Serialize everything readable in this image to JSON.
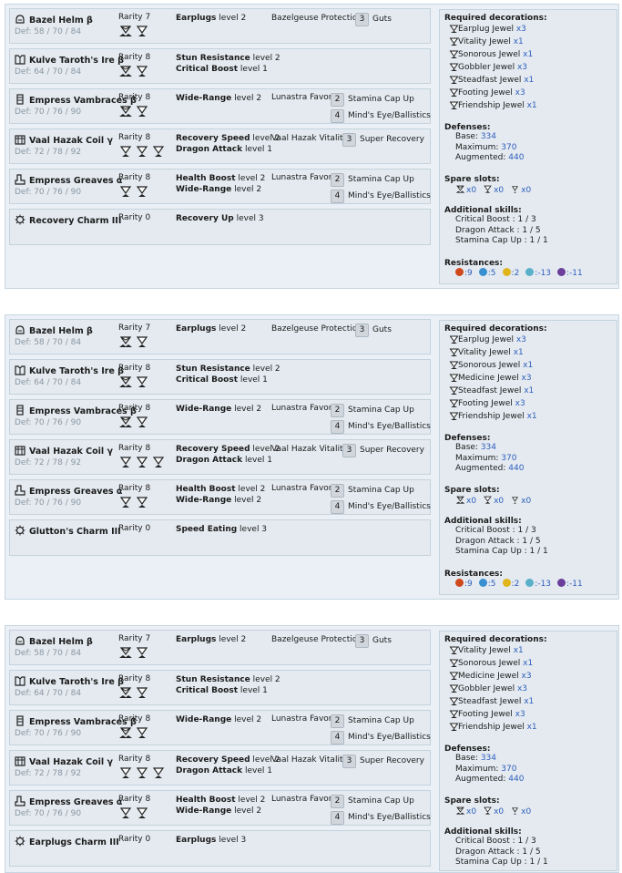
{
  "colors": {
    "accent": "#2f5fbd",
    "panel": "#e4eaf0",
    "border": "#c4d2dd"
  },
  "builds": [
    {
      "pieces": [
        {
          "name": "Bazel Helm β",
          "icon": "helm-icon",
          "def": "Def: 58 / 70 / 84",
          "rarity": "Rarity 7",
          "slots": [
            "large-slot",
            "medium-slot"
          ],
          "skills": [
            {
              "name": "Earplugs",
              "level": "level 2"
            }
          ],
          "set": "Bazelgeuse Protection",
          "bonuses": [
            {
              "n": "3",
              "text": "Guts"
            }
          ]
        },
        {
          "name": "Kulve Taroth's Ire β",
          "icon": "chest-icon",
          "def": "Def: 64 / 70 / 84",
          "rarity": "Rarity 8",
          "slots": [
            "large-slot",
            "medium-slot"
          ],
          "skills": [
            {
              "name": "Stun Resistance",
              "level": "level 2"
            },
            {
              "name": "Critical Boost",
              "level": "level 1"
            }
          ],
          "set": "",
          "bonuses": []
        },
        {
          "name": "Empress Vambraces β",
          "icon": "arms-icon",
          "def": "Def: 70 / 76 / 90",
          "rarity": "Rarity 8",
          "slots": [
            "large-slot",
            "medium-slot"
          ],
          "skills": [
            {
              "name": "Wide-Range",
              "level": "level 2"
            }
          ],
          "set": "Lunastra Favor",
          "bonuses": [
            {
              "n": "2",
              "text": "Stamina Cap Up"
            },
            {
              "n": "4",
              "text": "Mind's Eye/Ballistics"
            }
          ]
        },
        {
          "name": "Vaal Hazak Coil γ",
          "icon": "waist-icon",
          "def": "Def: 72 / 78 / 92",
          "rarity": "Rarity 8",
          "slots": [
            "medium-slot",
            "medium-slot",
            "medium-slot"
          ],
          "skills": [
            {
              "name": "Recovery Speed",
              "level": "level 2"
            },
            {
              "name": "Dragon Attack",
              "level": "level 1"
            }
          ],
          "set": "Vaal Hazak Vitality",
          "bonuses": [
            {
              "n": "3",
              "text": "Super Recovery"
            }
          ]
        },
        {
          "name": "Empress Greaves α",
          "icon": "legs-icon",
          "def": "Def: 70 / 76 / 90",
          "rarity": "Rarity 8",
          "slots": [
            "medium-slot",
            "medium-slot"
          ],
          "skills": [
            {
              "name": "Health Boost",
              "level": "level 2"
            },
            {
              "name": "Wide-Range",
              "level": "level 2"
            }
          ],
          "set": "Lunastra Favor",
          "bonuses": [
            {
              "n": "2",
              "text": "Stamina Cap Up"
            },
            {
              "n": "4",
              "text": "Mind's Eye/Ballistics"
            }
          ]
        },
        {
          "name": "Recovery Charm III",
          "icon": "charm-icon",
          "def": "",
          "rarity": "Rarity 0",
          "slots": [],
          "skills": [
            {
              "name": "Recovery Up",
              "level": "level 3"
            }
          ],
          "set": "",
          "bonuses": []
        }
      ],
      "side": {
        "decorations_title": "Required decorations:",
        "decorations": [
          {
            "name": "Earplug Jewel",
            "count": "x3"
          },
          {
            "name": "Vitality Jewel",
            "count": "x1"
          },
          {
            "name": "Sonorous Jewel",
            "count": "x1"
          },
          {
            "name": "Gobbler Jewel",
            "count": "x3"
          },
          {
            "name": "Steadfast Jewel",
            "count": "x1"
          },
          {
            "name": "Footing Jewel",
            "count": "x3"
          },
          {
            "name": "Friendship Jewel",
            "count": "x1"
          }
        ],
        "defenses_title": "Defenses:",
        "defenses": [
          {
            "label": "Base:",
            "value": "334"
          },
          {
            "label": "Maximum:",
            "value": "370"
          },
          {
            "label": "Augmented:",
            "value": "440"
          }
        ],
        "spare_title": "Spare slots:",
        "spare": [
          "x0",
          "x0",
          "x0"
        ],
        "addl_title": "Additional skills:",
        "addl": [
          "Critical Boost : 1 / 3",
          "Dragon Attack : 1 / 5",
          "Stamina Cap Up : 1 / 1"
        ],
        "res_title": "Resistances:",
        "res": [
          ":9",
          ":5",
          ":2",
          ":-13",
          ":-11"
        ]
      }
    },
    {
      "pieces": [
        {
          "name": "Bazel Helm β",
          "icon": "helm-icon",
          "def": "Def: 58 / 70 / 84",
          "rarity": "Rarity 7",
          "slots": [
            "large-slot",
            "medium-slot"
          ],
          "skills": [
            {
              "name": "Earplugs",
              "level": "level 2"
            }
          ],
          "set": "Bazelgeuse Protection",
          "bonuses": [
            {
              "n": "3",
              "text": "Guts"
            }
          ]
        },
        {
          "name": "Kulve Taroth's Ire β",
          "icon": "chest-icon",
          "def": "Def: 64 / 70 / 84",
          "rarity": "Rarity 8",
          "slots": [
            "large-slot",
            "medium-slot"
          ],
          "skills": [
            {
              "name": "Stun Resistance",
              "level": "level 2"
            },
            {
              "name": "Critical Boost",
              "level": "level 1"
            }
          ],
          "set": "",
          "bonuses": []
        },
        {
          "name": "Empress Vambraces β",
          "icon": "arms-icon",
          "def": "Def: 70 / 76 / 90",
          "rarity": "Rarity 8",
          "slots": [
            "large-slot",
            "medium-slot"
          ],
          "skills": [
            {
              "name": "Wide-Range",
              "level": "level 2"
            }
          ],
          "set": "Lunastra Favor",
          "bonuses": [
            {
              "n": "2",
              "text": "Stamina Cap Up"
            },
            {
              "n": "4",
              "text": "Mind's Eye/Ballistics"
            }
          ]
        },
        {
          "name": "Vaal Hazak Coil γ",
          "icon": "waist-icon",
          "def": "Def: 72 / 78 / 92",
          "rarity": "Rarity 8",
          "slots": [
            "medium-slot",
            "medium-slot",
            "medium-slot"
          ],
          "skills": [
            {
              "name": "Recovery Speed",
              "level": "level 2"
            },
            {
              "name": "Dragon Attack",
              "level": "level 1"
            }
          ],
          "set": "Vaal Hazak Vitality",
          "bonuses": [
            {
              "n": "3",
              "text": "Super Recovery"
            }
          ]
        },
        {
          "name": "Empress Greaves α",
          "icon": "legs-icon",
          "def": "Def: 70 / 76 / 90",
          "rarity": "Rarity 8",
          "slots": [
            "medium-slot",
            "medium-slot"
          ],
          "skills": [
            {
              "name": "Health Boost",
              "level": "level 2"
            },
            {
              "name": "Wide-Range",
              "level": "level 2"
            }
          ],
          "set": "Lunastra Favor",
          "bonuses": [
            {
              "n": "2",
              "text": "Stamina Cap Up"
            },
            {
              "n": "4",
              "text": "Mind's Eye/Ballistics"
            }
          ]
        },
        {
          "name": "Glutton's Charm III",
          "icon": "charm-icon",
          "def": "",
          "rarity": "Rarity 0",
          "slots": [],
          "skills": [
            {
              "name": "Speed Eating",
              "level": "level 3"
            }
          ],
          "set": "",
          "bonuses": []
        }
      ],
      "side": {
        "decorations_title": "Required decorations:",
        "decorations": [
          {
            "name": "Earplug Jewel",
            "count": "x3"
          },
          {
            "name": "Vitality Jewel",
            "count": "x1"
          },
          {
            "name": "Sonorous Jewel",
            "count": "x1"
          },
          {
            "name": "Medicine Jewel",
            "count": "x3"
          },
          {
            "name": "Steadfast Jewel",
            "count": "x1"
          },
          {
            "name": "Footing Jewel",
            "count": "x3"
          },
          {
            "name": "Friendship Jewel",
            "count": "x1"
          }
        ],
        "defenses_title": "Defenses:",
        "defenses": [
          {
            "label": "Base:",
            "value": "334"
          },
          {
            "label": "Maximum:",
            "value": "370"
          },
          {
            "label": "Augmented:",
            "value": "440"
          }
        ],
        "spare_title": "Spare slots:",
        "spare": [
          "x0",
          "x0",
          "x0"
        ],
        "addl_title": "Additional skills:",
        "addl": [
          "Critical Boost : 1 / 3",
          "Dragon Attack : 1 / 5",
          "Stamina Cap Up : 1 / 1"
        ],
        "res_title": "Resistances:",
        "res": [
          ":9",
          ":5",
          ":2",
          ":-13",
          ":-11"
        ]
      }
    },
    {
      "pieces": [
        {
          "name": "Bazel Helm β",
          "icon": "helm-icon",
          "def": "Def: 58 / 70 / 84",
          "rarity": "Rarity 7",
          "slots": [
            "large-slot",
            "medium-slot"
          ],
          "skills": [
            {
              "name": "Earplugs",
              "level": "level 2"
            }
          ],
          "set": "Bazelgeuse Protection",
          "bonuses": [
            {
              "n": "3",
              "text": "Guts"
            }
          ]
        },
        {
          "name": "Kulve Taroth's Ire β",
          "icon": "chest-icon",
          "def": "Def: 64 / 70 / 84",
          "rarity": "Rarity 8",
          "slots": [
            "large-slot",
            "medium-slot"
          ],
          "skills": [
            {
              "name": "Stun Resistance",
              "level": "level 2"
            },
            {
              "name": "Critical Boost",
              "level": "level 1"
            }
          ],
          "set": "",
          "bonuses": []
        },
        {
          "name": "Empress Vambraces β",
          "icon": "arms-icon",
          "def": "Def: 70 / 76 / 90",
          "rarity": "Rarity 8",
          "slots": [
            "large-slot",
            "medium-slot"
          ],
          "skills": [
            {
              "name": "Wide-Range",
              "level": "level 2"
            }
          ],
          "set": "Lunastra Favor",
          "bonuses": [
            {
              "n": "2",
              "text": "Stamina Cap Up"
            },
            {
              "n": "4",
              "text": "Mind's Eye/Ballistics"
            }
          ]
        },
        {
          "name": "Vaal Hazak Coil γ",
          "icon": "waist-icon",
          "def": "Def: 72 / 78 / 92",
          "rarity": "Rarity 8",
          "slots": [
            "medium-slot",
            "medium-slot",
            "medium-slot"
          ],
          "skills": [
            {
              "name": "Recovery Speed",
              "level": "level 2"
            },
            {
              "name": "Dragon Attack",
              "level": "level 1"
            }
          ],
          "set": "Vaal Hazak Vitality",
          "bonuses": [
            {
              "n": "3",
              "text": "Super Recovery"
            }
          ]
        },
        {
          "name": "Empress Greaves α",
          "icon": "legs-icon",
          "def": "Def: 70 / 76 / 90",
          "rarity": "Rarity 8",
          "slots": [
            "medium-slot",
            "medium-slot"
          ],
          "skills": [
            {
              "name": "Health Boost",
              "level": "level 2"
            },
            {
              "name": "Wide-Range",
              "level": "level 2"
            }
          ],
          "set": "Lunastra Favor",
          "bonuses": [
            {
              "n": "2",
              "text": "Stamina Cap Up"
            },
            {
              "n": "4",
              "text": "Mind's Eye/Ballistics"
            }
          ]
        },
        {
          "name": "Earplugs Charm III",
          "icon": "charm-icon",
          "def": "",
          "rarity": "Rarity 0",
          "slots": [],
          "skills": [
            {
              "name": "Earplugs",
              "level": "level 3"
            }
          ],
          "set": "",
          "bonuses": []
        }
      ],
      "side": {
        "decorations_title": "Required decorations:",
        "decorations": [
          {
            "name": "Vitality Jewel",
            "count": "x1"
          },
          {
            "name": "Sonorous Jewel",
            "count": "x1"
          },
          {
            "name": "Medicine Jewel",
            "count": "x3"
          },
          {
            "name": "Gobbler Jewel",
            "count": "x3"
          },
          {
            "name": "Steadfast Jewel",
            "count": "x1"
          },
          {
            "name": "Footing Jewel",
            "count": "x3"
          },
          {
            "name": "Friendship Jewel",
            "count": "x1"
          }
        ],
        "defenses_title": "Defenses:",
        "defenses": [
          {
            "label": "Base:",
            "value": "334"
          },
          {
            "label": "Maximum:",
            "value": "370"
          },
          {
            "label": "Augmented:",
            "value": "440"
          }
        ],
        "spare_title": "Spare slots:",
        "spare": [
          "x0",
          "x0",
          "x0"
        ],
        "addl_title": "Additional skills:",
        "addl": [
          "Critical Boost : 1 / 3",
          "Dragon Attack : 1 / 5",
          "Stamina Cap Up : 1 / 1"
        ],
        "res_title": "Resistances:",
        "res": []
      }
    }
  ]
}
